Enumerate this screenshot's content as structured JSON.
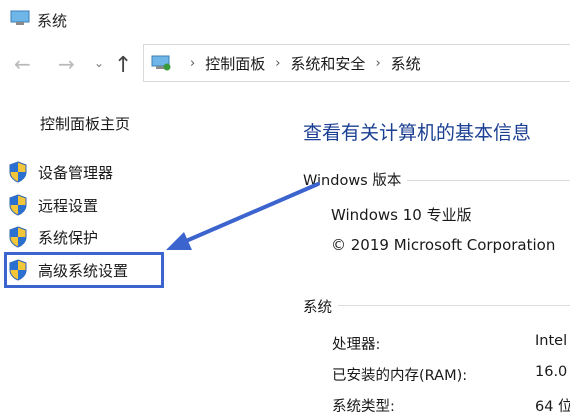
{
  "window": {
    "title": "系统"
  },
  "nav": {
    "breadcrumb": [
      "控制面板",
      "系统和安全",
      "系统"
    ]
  },
  "sidebar": {
    "home": "控制面板主页",
    "items": [
      {
        "label": "设备管理器"
      },
      {
        "label": "远程设置"
      },
      {
        "label": "系统保护"
      },
      {
        "label": "高级系统设置"
      }
    ]
  },
  "main": {
    "title": "查看有关计算机的基本信息",
    "windows_edition": {
      "heading": "Windows 版本",
      "edition": "Windows 10 专业版",
      "copyright": "© 2019 Microsoft Corporation"
    },
    "system": {
      "heading": "系统",
      "rows": [
        {
          "label": "处理器:",
          "value": "Intel"
        },
        {
          "label": "已安装的内存(RAM):",
          "value": "16.0"
        },
        {
          "label": "系统类型:",
          "value": "64 位"
        }
      ]
    }
  },
  "colors": {
    "accent": "#1b3f92",
    "highlight": "#3c64cf"
  }
}
